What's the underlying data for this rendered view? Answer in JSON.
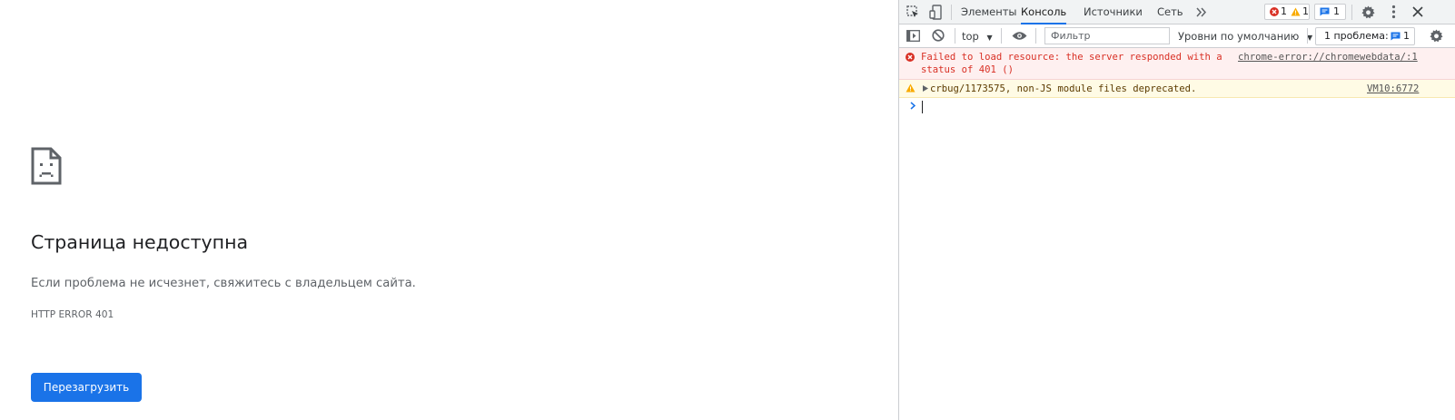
{
  "page": {
    "title": "Страница недоступна",
    "message": "Если проблема не исчезнет, свяжитесь с владельцем сайта.",
    "error_code": "HTTP ERROR 401",
    "reload_label": "Перезагрузить",
    "icon": "sad-document-icon",
    "button_color": "#1a73e8"
  },
  "devtools": {
    "tabs": [
      {
        "label": "Элементы",
        "active": false
      },
      {
        "label": "Консоль",
        "active": true
      },
      {
        "label": "Источники",
        "active": false
      },
      {
        "label": "Сеть",
        "active": false
      }
    ],
    "more_tabs_icon": "double-chevron-icon",
    "error_count": "1",
    "warning_count": "1",
    "issue_count": "1",
    "toolbar": {
      "context": "top",
      "filter_placeholder": "Фильтр",
      "levels": "Уровни по умолчанию",
      "issues_label": "1 проблема:",
      "issues_count": "1"
    },
    "messages": [
      {
        "level": "error",
        "line1": "Failed to load resource: the server responded with a",
        "line2": "status of 401 ()",
        "source": "chrome-error://chromewebdata/:1"
      },
      {
        "level": "warning",
        "text": "crbug/1173575, non-JS module files deprecated.",
        "source": "VM10:6772"
      }
    ],
    "colors": {
      "accent": "#1a73e8",
      "error": "#d93025",
      "warning": "#f9ab00"
    }
  }
}
